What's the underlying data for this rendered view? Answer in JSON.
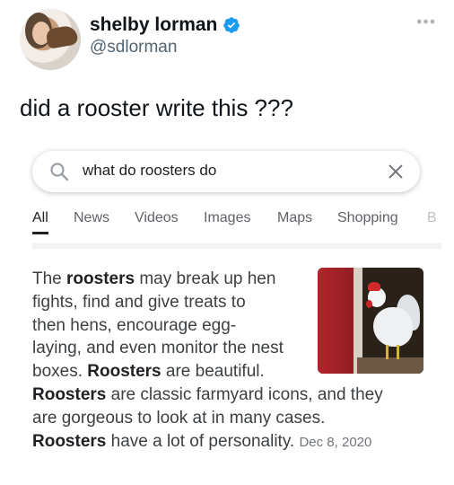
{
  "tweet": {
    "display_name": "shelby lorman",
    "handle": "@sdlorman",
    "text": "did a rooster write this ???",
    "more_glyph": "•••",
    "verified_color": "#1d9bf0"
  },
  "search": {
    "query": "what do roosters do"
  },
  "tabs": [
    {
      "label": "All",
      "active": true
    },
    {
      "label": "News"
    },
    {
      "label": "Videos"
    },
    {
      "label": "Images"
    },
    {
      "label": "Maps"
    },
    {
      "label": "Shopping"
    },
    {
      "label": "B"
    }
  ],
  "snippet": {
    "p1": "The ",
    "b1": "roosters",
    "p2": " may break up hen",
    "line2": "fights, find and give treats to",
    "line3": "then hens, encourage egg-",
    "line4": "laying, and even monitor the nest",
    "line5a": "boxes. ",
    "b2": "Roosters",
    "line5b": " are beautiful.",
    "b3": "Roosters",
    "line6b": " are classic farmyard icons, and they",
    "line7": "are gorgeous to look at in many cases.",
    "b4": "Roosters",
    "line8b": " have a lot of personality.",
    "date": "Dec 8, 2020"
  },
  "icons": {
    "avatar": "profile-photo",
    "verified": "verified-badge-icon",
    "search": "search-icon",
    "close": "close-icon",
    "thumbnail": "rooster-image"
  }
}
